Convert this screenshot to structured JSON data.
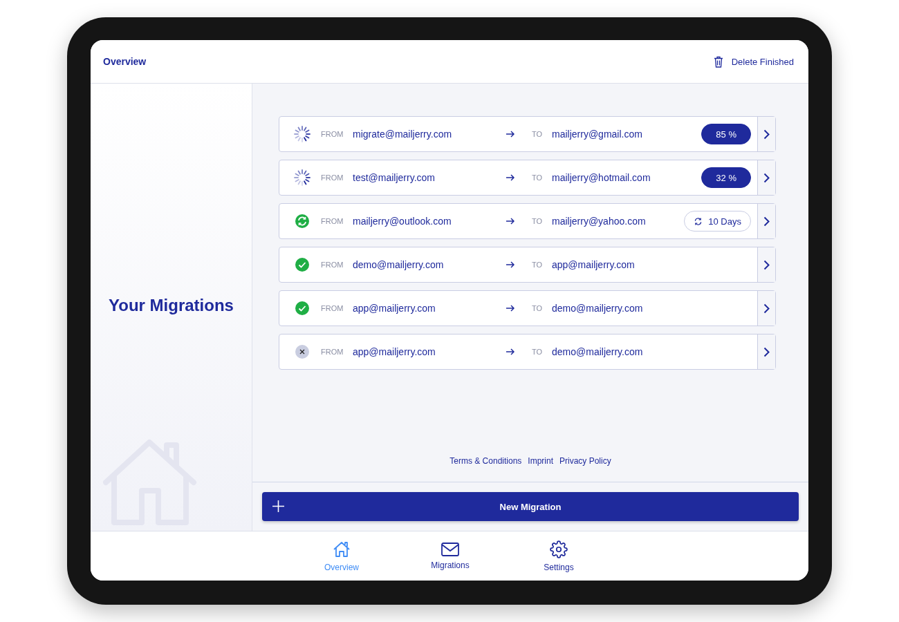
{
  "header": {
    "title": "Overview",
    "action": "Delete Finished"
  },
  "sidebar": {
    "title": "Your Migrations"
  },
  "migrations": [
    {
      "kind": "running",
      "from_label": "FROM",
      "from": "migrate@mailjerry.com",
      "to_label": "TO",
      "to": "mailjerry@gmail.com",
      "badge": {
        "kind": "progress",
        "text": "85 %"
      }
    },
    {
      "kind": "running",
      "from_label": "FROM",
      "from": "test@mailjerry.com",
      "to_label": "TO",
      "to": "mailjerry@hotmail.com",
      "badge": {
        "kind": "progress",
        "text": "32 %"
      }
    },
    {
      "kind": "recurring",
      "from_label": "FROM",
      "from": "mailjerry@outlook.com",
      "to_label": "TO",
      "to": "mailjerry@yahoo.com",
      "badge": {
        "kind": "interval",
        "text": "10 Days"
      }
    },
    {
      "kind": "done",
      "from_label": "FROM",
      "from": "demo@mailjerry.com",
      "to_label": "TO",
      "to": "app@mailjerry.com"
    },
    {
      "kind": "done",
      "from_label": "FROM",
      "from": "app@mailjerry.com",
      "to_label": "TO",
      "to": "demo@mailjerry.com"
    },
    {
      "kind": "cancelled",
      "from_label": "FROM",
      "from": "app@mailjerry.com",
      "to_label": "TO",
      "to": "demo@mailjerry.com"
    }
  ],
  "footer_links": [
    "Terms & Conditions",
    "Imprint",
    "Privacy Policy"
  ],
  "new_button": "New Migration",
  "nav": [
    {
      "kind": "home",
      "label": "Overview",
      "selected": true
    },
    {
      "kind": "mail",
      "label": "Migrations",
      "selected": false
    },
    {
      "kind": "gear",
      "label": "Settings",
      "selected": false
    }
  ]
}
